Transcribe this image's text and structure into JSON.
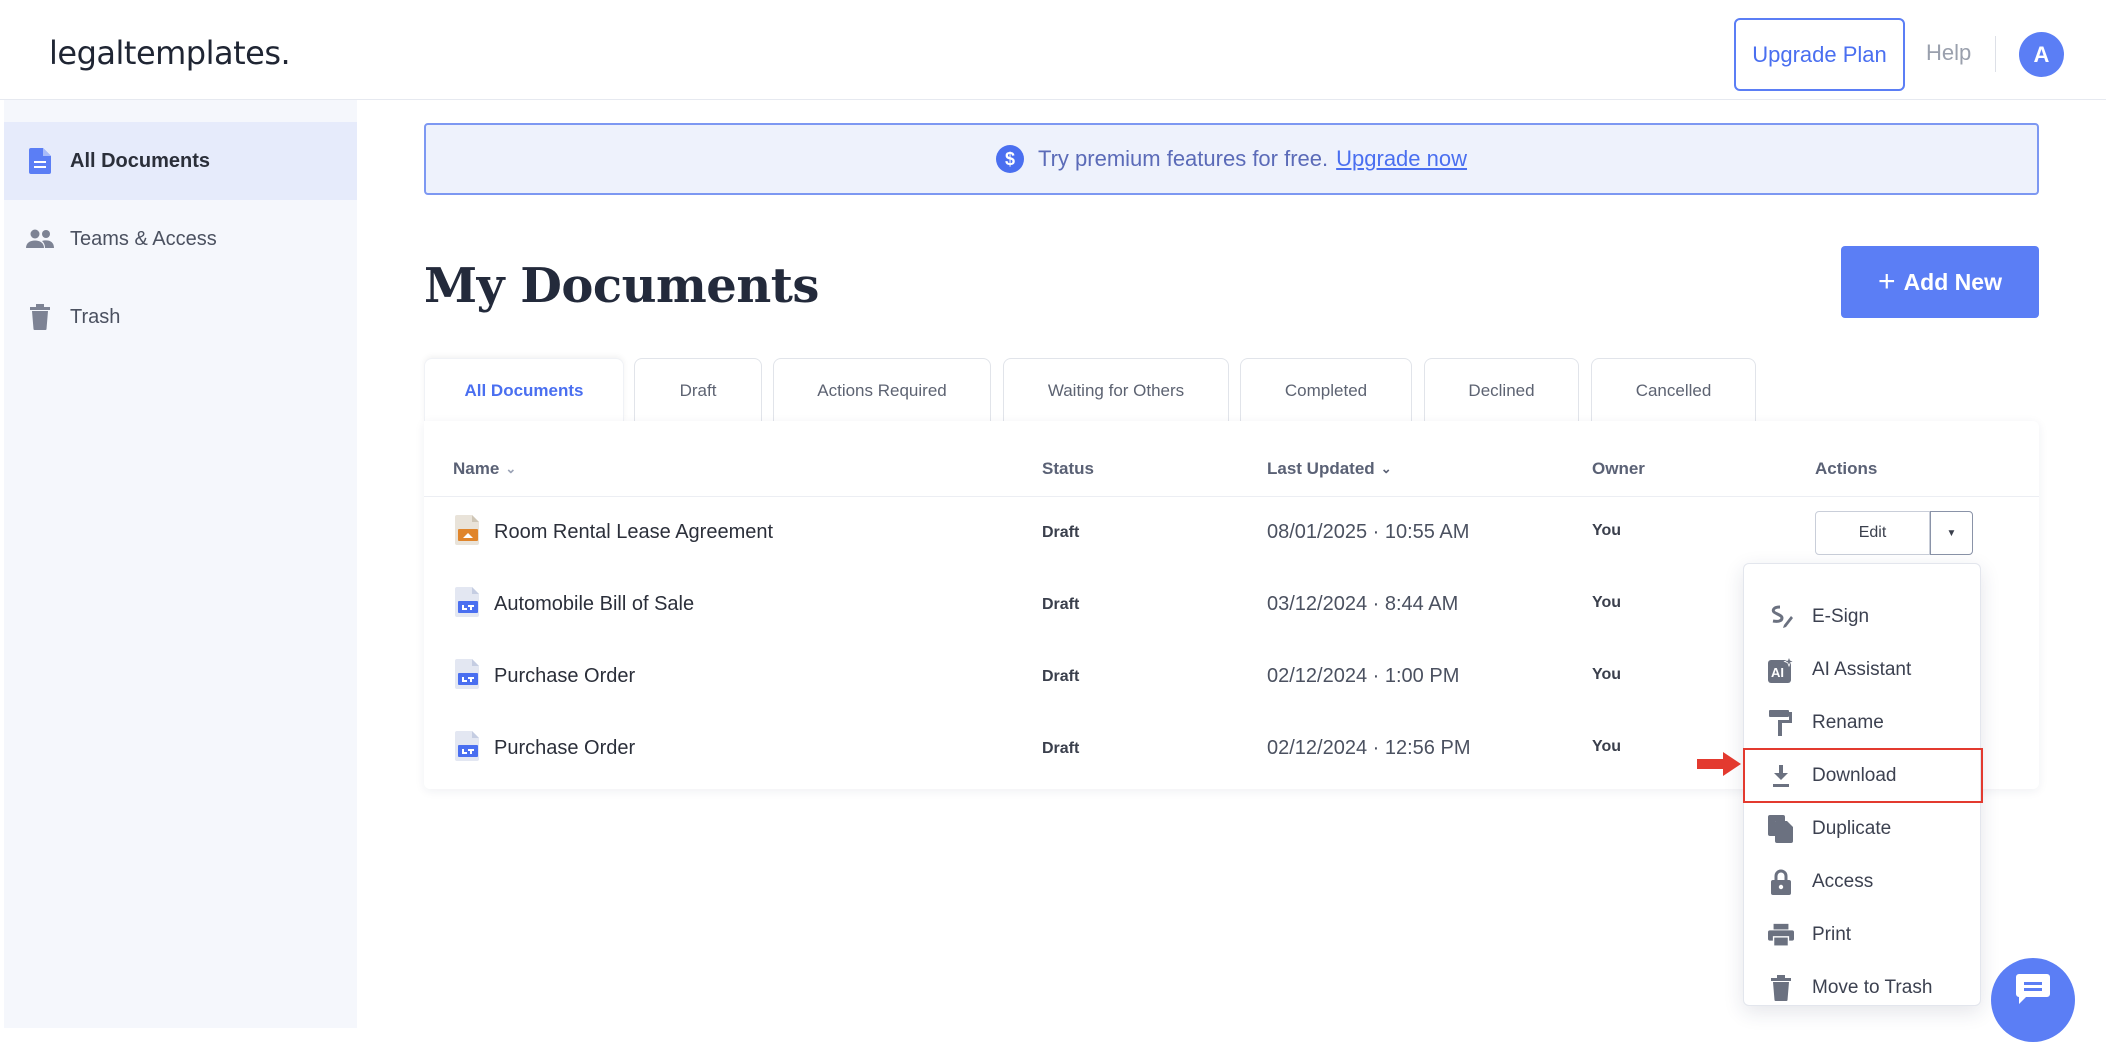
{
  "header": {
    "logo": "legaltemplates.",
    "upgrade_label": "Upgrade Plan",
    "help_label": "Help",
    "avatar_initial": "A"
  },
  "sidebar": {
    "items": [
      {
        "label": "All Documents",
        "icon": "document-icon",
        "active": true
      },
      {
        "label": "Teams & Access",
        "icon": "people-icon",
        "active": false
      },
      {
        "label": "Trash",
        "icon": "trash-icon",
        "active": false
      }
    ]
  },
  "promo": {
    "text": "Try premium features for free.",
    "link": "Upgrade now",
    "icon_glyph": "$"
  },
  "main": {
    "title": "My Documents",
    "add_label": "Add New",
    "add_glyph": "+"
  },
  "tabs": [
    {
      "label": "All Documents",
      "active": true
    },
    {
      "label": "Draft"
    },
    {
      "label": "Actions Required"
    },
    {
      "label": "Waiting for Others"
    },
    {
      "label": "Completed"
    },
    {
      "label": "Declined"
    },
    {
      "label": "Cancelled"
    }
  ],
  "table": {
    "columns": {
      "name": "Name",
      "status": "Status",
      "last_updated": "Last Updated",
      "owner": "Owner",
      "actions": "Actions"
    },
    "rows": [
      {
        "name": "Room Rental Lease Agreement",
        "status": "Draft",
        "date": "08/01/2025 · 10:55 AM",
        "owner": "You",
        "icon": "lease-doc-icon"
      },
      {
        "name": "Automobile Bill of Sale",
        "status": "Draft",
        "date": "03/12/2024 · 8:44 AM",
        "owner": "You",
        "icon": "lt-doc-icon"
      },
      {
        "name": "Purchase Order",
        "status": "Draft",
        "date": "02/12/2024 · 1:00 PM",
        "owner": "You",
        "icon": "lt-doc-icon"
      },
      {
        "name": "Purchase Order",
        "status": "Draft",
        "date": "02/12/2024 · 12:56 PM",
        "owner": "You",
        "icon": "lt-doc-icon"
      }
    ],
    "edit_label": "Edit"
  },
  "menu": {
    "items": [
      {
        "label": "E-Sign",
        "icon": "esign-icon"
      },
      {
        "label": "AI Assistant",
        "icon": "ai-assistant-icon"
      },
      {
        "label": "Rename",
        "icon": "paint-roller-icon"
      },
      {
        "label": "Download",
        "icon": "download-icon",
        "highlighted": true
      },
      {
        "label": "Duplicate",
        "icon": "duplicate-icon"
      },
      {
        "label": "Access",
        "icon": "lock-icon"
      },
      {
        "label": "Print",
        "icon": "print-icon"
      },
      {
        "label": "Move to Trash",
        "icon": "trash-icon"
      }
    ]
  },
  "colors": {
    "accent": "#5b7ef5",
    "highlight_red": "#e33a2f",
    "sidebar_bg": "#f5f7fc",
    "promo_bg": "#eef2fc"
  }
}
